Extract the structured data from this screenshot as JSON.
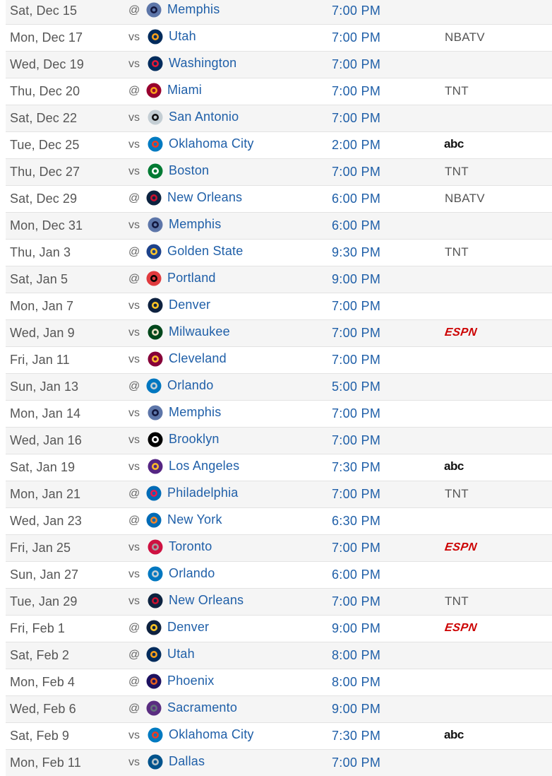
{
  "games": [
    {
      "date": "Sat, Dec 15",
      "ha": "@",
      "opponent": "Memphis",
      "logo": "grizzlies-logo",
      "time": "7:00 PM",
      "tv": ""
    },
    {
      "date": "Mon, Dec 17",
      "ha": "vs",
      "opponent": "Utah",
      "logo": "jazz-logo",
      "time": "7:00 PM",
      "tv": "NBATV"
    },
    {
      "date": "Wed, Dec 19",
      "ha": "vs",
      "opponent": "Washington",
      "logo": "wizards-logo",
      "time": "7:00 PM",
      "tv": ""
    },
    {
      "date": "Thu, Dec 20",
      "ha": "@",
      "opponent": "Miami",
      "logo": "heat-logo",
      "time": "7:00 PM",
      "tv": "TNT"
    },
    {
      "date": "Sat, Dec 22",
      "ha": "vs",
      "opponent": "San Antonio",
      "logo": "spurs-logo",
      "time": "7:00 PM",
      "tv": ""
    },
    {
      "date": "Tue, Dec 25",
      "ha": "vs",
      "opponent": "Oklahoma City",
      "logo": "thunder-logo",
      "time": "2:00 PM",
      "tv": "abc"
    },
    {
      "date": "Thu, Dec 27",
      "ha": "vs",
      "opponent": "Boston",
      "logo": "celtics-logo",
      "time": "7:00 PM",
      "tv": "TNT"
    },
    {
      "date": "Sat, Dec 29",
      "ha": "@",
      "opponent": "New Orleans",
      "logo": "pelicans-logo",
      "time": "6:00 PM",
      "tv": "NBATV"
    },
    {
      "date": "Mon, Dec 31",
      "ha": "vs",
      "opponent": "Memphis",
      "logo": "grizzlies-logo",
      "time": "6:00 PM",
      "tv": ""
    },
    {
      "date": "Thu, Jan 3",
      "ha": "@",
      "opponent": "Golden State",
      "logo": "warriors-logo",
      "time": "9:30 PM",
      "tv": "TNT"
    },
    {
      "date": "Sat, Jan 5",
      "ha": "@",
      "opponent": "Portland",
      "logo": "blazers-logo",
      "time": "9:00 PM",
      "tv": ""
    },
    {
      "date": "Mon, Jan 7",
      "ha": "vs",
      "opponent": "Denver",
      "logo": "nuggets-logo",
      "time": "7:00 PM",
      "tv": ""
    },
    {
      "date": "Wed, Jan 9",
      "ha": "vs",
      "opponent": "Milwaukee",
      "logo": "bucks-logo",
      "time": "7:00 PM",
      "tv": "ESPN"
    },
    {
      "date": "Fri, Jan 11",
      "ha": "vs",
      "opponent": "Cleveland",
      "logo": "cavaliers-logo",
      "time": "7:00 PM",
      "tv": ""
    },
    {
      "date": "Sun, Jan 13",
      "ha": "@",
      "opponent": "Orlando",
      "logo": "magic-logo",
      "time": "5:00 PM",
      "tv": ""
    },
    {
      "date": "Mon, Jan 14",
      "ha": "vs",
      "opponent": "Memphis",
      "logo": "grizzlies-logo",
      "time": "7:00 PM",
      "tv": ""
    },
    {
      "date": "Wed, Jan 16",
      "ha": "vs",
      "opponent": "Brooklyn",
      "logo": "nets-logo",
      "time": "7:00 PM",
      "tv": ""
    },
    {
      "date": "Sat, Jan 19",
      "ha": "vs",
      "opponent": "Los Angeles",
      "logo": "lakers-logo",
      "time": "7:30 PM",
      "tv": "abc"
    },
    {
      "date": "Mon, Jan 21",
      "ha": "@",
      "opponent": "Philadelphia",
      "logo": "76ers-logo",
      "time": "7:00 PM",
      "tv": "TNT"
    },
    {
      "date": "Wed, Jan 23",
      "ha": "@",
      "opponent": "New York",
      "logo": "knicks-logo",
      "time": "6:30 PM",
      "tv": ""
    },
    {
      "date": "Fri, Jan 25",
      "ha": "vs",
      "opponent": "Toronto",
      "logo": "raptors-logo",
      "time": "7:00 PM",
      "tv": "ESPN"
    },
    {
      "date": "Sun, Jan 27",
      "ha": "vs",
      "opponent": "Orlando",
      "logo": "magic-logo",
      "time": "6:00 PM",
      "tv": ""
    },
    {
      "date": "Tue, Jan 29",
      "ha": "vs",
      "opponent": "New Orleans",
      "logo": "pelicans-logo",
      "time": "7:00 PM",
      "tv": "TNT"
    },
    {
      "date": "Fri, Feb 1",
      "ha": "@",
      "opponent": "Denver",
      "logo": "nuggets-logo",
      "time": "9:00 PM",
      "tv": "ESPN"
    },
    {
      "date": "Sat, Feb 2",
      "ha": "@",
      "opponent": "Utah",
      "logo": "jazz-logo",
      "time": "8:00 PM",
      "tv": ""
    },
    {
      "date": "Mon, Feb 4",
      "ha": "@",
      "opponent": "Phoenix",
      "logo": "suns-logo",
      "time": "8:00 PM",
      "tv": ""
    },
    {
      "date": "Wed, Feb 6",
      "ha": "@",
      "opponent": "Sacramento",
      "logo": "kings-logo",
      "time": "9:00 PM",
      "tv": ""
    },
    {
      "date": "Sat, Feb 9",
      "ha": "vs",
      "opponent": "Oklahoma City",
      "logo": "thunder-logo",
      "time": "7:30 PM",
      "tv": "abc"
    },
    {
      "date": "Mon, Feb 11",
      "ha": "vs",
      "opponent": "Dallas",
      "logo": "mavericks-logo",
      "time": "7:00 PM",
      "tv": ""
    }
  ],
  "logo_colors": {
    "grizzlies-logo": [
      "#5d76a9",
      "#12173f"
    ],
    "jazz-logo": [
      "#002b5c",
      "#f9a01b"
    ],
    "wizards-logo": [
      "#002b5c",
      "#e31837"
    ],
    "heat-logo": [
      "#98002e",
      "#f9a01b"
    ],
    "spurs-logo": [
      "#c4ced4",
      "#111111"
    ],
    "thunder-logo": [
      "#007ac1",
      "#ef3b24"
    ],
    "celtics-logo": [
      "#007a33",
      "#ffffff"
    ],
    "pelicans-logo": [
      "#0c2340",
      "#c8102e"
    ],
    "warriors-logo": [
      "#1d428a",
      "#ffc72c"
    ],
    "blazers-logo": [
      "#e03a3e",
      "#000000"
    ],
    "nuggets-logo": [
      "#0e2240",
      "#fec524"
    ],
    "bucks-logo": [
      "#00471b",
      "#eee1c6"
    ],
    "cavaliers-logo": [
      "#860038",
      "#fdbb30"
    ],
    "magic-logo": [
      "#0077c0",
      "#c4ced4"
    ],
    "nets-logo": [
      "#000000",
      "#ffffff"
    ],
    "lakers-logo": [
      "#552583",
      "#fdb927"
    ],
    "76ers-logo": [
      "#006bb6",
      "#ed174c"
    ],
    "knicks-logo": [
      "#006bb6",
      "#f58426"
    ],
    "raptors-logo": [
      "#ce1141",
      "#a1a1a4"
    ],
    "suns-logo": [
      "#1d1160",
      "#e56020"
    ],
    "kings-logo": [
      "#5a2d81",
      "#63727a"
    ],
    "mavericks-logo": [
      "#00538c",
      "#b8c4ca"
    ]
  }
}
